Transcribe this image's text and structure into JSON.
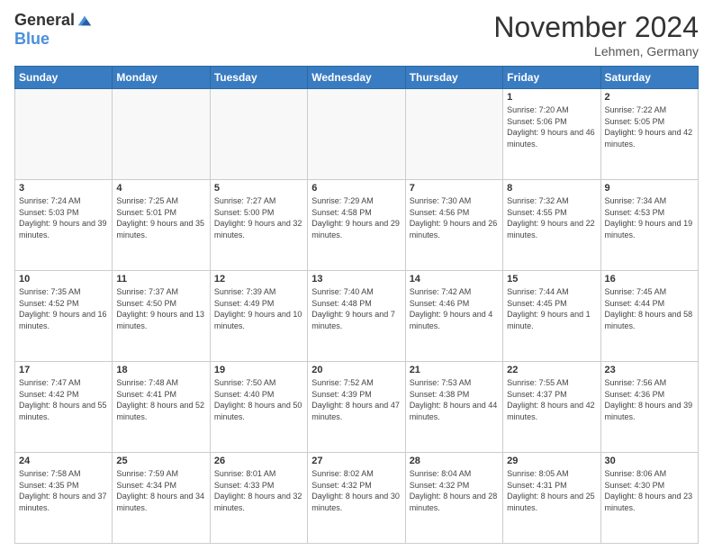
{
  "logo": {
    "general": "General",
    "blue": "Blue"
  },
  "header": {
    "title": "November 2024",
    "location": "Lehmen, Germany"
  },
  "days_of_week": [
    "Sunday",
    "Monday",
    "Tuesday",
    "Wednesday",
    "Thursday",
    "Friday",
    "Saturday"
  ],
  "weeks": [
    [
      {
        "day": "",
        "info": ""
      },
      {
        "day": "",
        "info": ""
      },
      {
        "day": "",
        "info": ""
      },
      {
        "day": "",
        "info": ""
      },
      {
        "day": "",
        "info": ""
      },
      {
        "day": "1",
        "info": "Sunrise: 7:20 AM\nSunset: 5:06 PM\nDaylight: 9 hours and 46 minutes."
      },
      {
        "day": "2",
        "info": "Sunrise: 7:22 AM\nSunset: 5:05 PM\nDaylight: 9 hours and 42 minutes."
      }
    ],
    [
      {
        "day": "3",
        "info": "Sunrise: 7:24 AM\nSunset: 5:03 PM\nDaylight: 9 hours and 39 minutes."
      },
      {
        "day": "4",
        "info": "Sunrise: 7:25 AM\nSunset: 5:01 PM\nDaylight: 9 hours and 35 minutes."
      },
      {
        "day": "5",
        "info": "Sunrise: 7:27 AM\nSunset: 5:00 PM\nDaylight: 9 hours and 32 minutes."
      },
      {
        "day": "6",
        "info": "Sunrise: 7:29 AM\nSunset: 4:58 PM\nDaylight: 9 hours and 29 minutes."
      },
      {
        "day": "7",
        "info": "Sunrise: 7:30 AM\nSunset: 4:56 PM\nDaylight: 9 hours and 26 minutes."
      },
      {
        "day": "8",
        "info": "Sunrise: 7:32 AM\nSunset: 4:55 PM\nDaylight: 9 hours and 22 minutes."
      },
      {
        "day": "9",
        "info": "Sunrise: 7:34 AM\nSunset: 4:53 PM\nDaylight: 9 hours and 19 minutes."
      }
    ],
    [
      {
        "day": "10",
        "info": "Sunrise: 7:35 AM\nSunset: 4:52 PM\nDaylight: 9 hours and 16 minutes."
      },
      {
        "day": "11",
        "info": "Sunrise: 7:37 AM\nSunset: 4:50 PM\nDaylight: 9 hours and 13 minutes."
      },
      {
        "day": "12",
        "info": "Sunrise: 7:39 AM\nSunset: 4:49 PM\nDaylight: 9 hours and 10 minutes."
      },
      {
        "day": "13",
        "info": "Sunrise: 7:40 AM\nSunset: 4:48 PM\nDaylight: 9 hours and 7 minutes."
      },
      {
        "day": "14",
        "info": "Sunrise: 7:42 AM\nSunset: 4:46 PM\nDaylight: 9 hours and 4 minutes."
      },
      {
        "day": "15",
        "info": "Sunrise: 7:44 AM\nSunset: 4:45 PM\nDaylight: 9 hours and 1 minute."
      },
      {
        "day": "16",
        "info": "Sunrise: 7:45 AM\nSunset: 4:44 PM\nDaylight: 8 hours and 58 minutes."
      }
    ],
    [
      {
        "day": "17",
        "info": "Sunrise: 7:47 AM\nSunset: 4:42 PM\nDaylight: 8 hours and 55 minutes."
      },
      {
        "day": "18",
        "info": "Sunrise: 7:48 AM\nSunset: 4:41 PM\nDaylight: 8 hours and 52 minutes."
      },
      {
        "day": "19",
        "info": "Sunrise: 7:50 AM\nSunset: 4:40 PM\nDaylight: 8 hours and 50 minutes."
      },
      {
        "day": "20",
        "info": "Sunrise: 7:52 AM\nSunset: 4:39 PM\nDaylight: 8 hours and 47 minutes."
      },
      {
        "day": "21",
        "info": "Sunrise: 7:53 AM\nSunset: 4:38 PM\nDaylight: 8 hours and 44 minutes."
      },
      {
        "day": "22",
        "info": "Sunrise: 7:55 AM\nSunset: 4:37 PM\nDaylight: 8 hours and 42 minutes."
      },
      {
        "day": "23",
        "info": "Sunrise: 7:56 AM\nSunset: 4:36 PM\nDaylight: 8 hours and 39 minutes."
      }
    ],
    [
      {
        "day": "24",
        "info": "Sunrise: 7:58 AM\nSunset: 4:35 PM\nDaylight: 8 hours and 37 minutes."
      },
      {
        "day": "25",
        "info": "Sunrise: 7:59 AM\nSunset: 4:34 PM\nDaylight: 8 hours and 34 minutes."
      },
      {
        "day": "26",
        "info": "Sunrise: 8:01 AM\nSunset: 4:33 PM\nDaylight: 8 hours and 32 minutes."
      },
      {
        "day": "27",
        "info": "Sunrise: 8:02 AM\nSunset: 4:32 PM\nDaylight: 8 hours and 30 minutes."
      },
      {
        "day": "28",
        "info": "Sunrise: 8:04 AM\nSunset: 4:32 PM\nDaylight: 8 hours and 28 minutes."
      },
      {
        "day": "29",
        "info": "Sunrise: 8:05 AM\nSunset: 4:31 PM\nDaylight: 8 hours and 25 minutes."
      },
      {
        "day": "30",
        "info": "Sunrise: 8:06 AM\nSunset: 4:30 PM\nDaylight: 8 hours and 23 minutes."
      }
    ]
  ]
}
